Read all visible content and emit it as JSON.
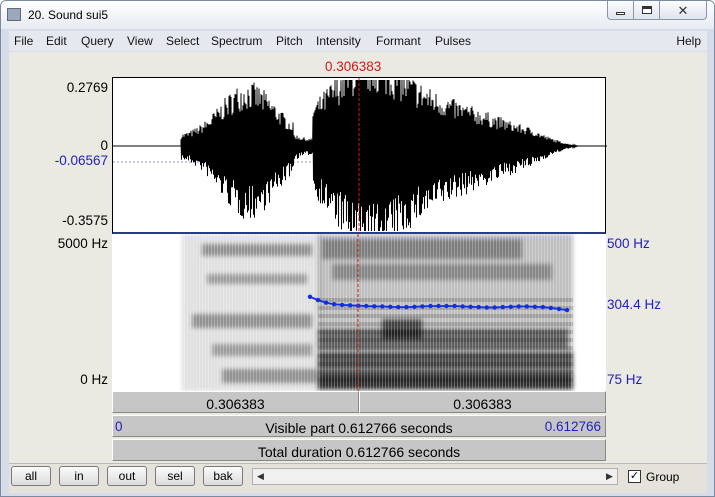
{
  "window": {
    "title": "20. Sound sui5",
    "icon": "praat-sound-icon",
    "controls": [
      "minimize-icon",
      "maximize-icon",
      "close-icon"
    ]
  },
  "menu": {
    "items": [
      "File",
      "Edit",
      "Query",
      "View",
      "Select",
      "Spectrum",
      "Pitch",
      "Intensity",
      "Formant",
      "Pulses"
    ],
    "help": "Help"
  },
  "cursor": {
    "time_label": "0.306383",
    "time": 0.306383
  },
  "waveform": {
    "y_max": "0.2769",
    "y_zero": "0",
    "y_cursor": "-0.06567",
    "y_min": "-0.3575"
  },
  "spectrogram": {
    "freq_max": "5000 Hz",
    "freq_min": "0 Hz"
  },
  "pitch": {
    "max": "500 Hz",
    "current": "304.4 Hz",
    "min": "75 Hz",
    "values_hz": [
      330,
      321,
      314,
      310,
      308,
      307,
      306,
      305,
      304.4,
      304,
      303,
      302,
      302,
      303,
      304,
      305,
      305,
      305,
      305,
      304,
      303,
      302,
      301,
      301,
      302,
      303,
      304,
      304,
      303,
      302,
      300,
      297,
      294
    ],
    "color": "#1030e0"
  },
  "time_bars": {
    "left_segment": "0.306383",
    "right_segment": "0.306383",
    "visible_start": "0",
    "visible_label": "Visible part 0.612766 seconds",
    "visible_end": "0.612766",
    "total_label": "Total duration 0.612766 seconds"
  },
  "buttons": {
    "all": "all",
    "in": "in",
    "out": "out",
    "sel": "sel",
    "bak": "bak"
  },
  "group": {
    "label": "Group",
    "checked": true,
    "mark": "✓"
  },
  "scrollbar": {
    "left_arrow": "◀",
    "right_arrow": "▶"
  },
  "colors": {
    "cursor": "#d01818",
    "axis_blue": "#2020c0",
    "pitch": "#1030e0"
  }
}
